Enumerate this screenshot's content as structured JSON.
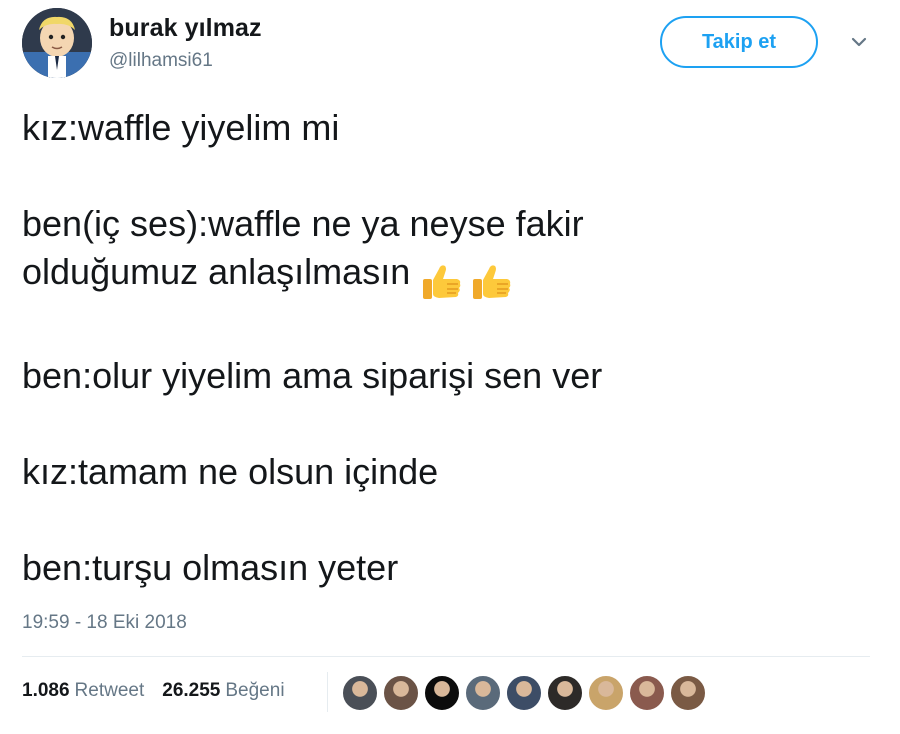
{
  "author": {
    "display_name": "burak yılmaz",
    "handle": "@lilhamsi61",
    "avatar_icon": "cartoon-character-avatar"
  },
  "follow_button": {
    "label": "Takip et",
    "color": "#1da1f2"
  },
  "menu_icon": "chevron-down-icon",
  "tweet": {
    "lines": [
      "kız:waffle yiyelim mi",
      "ben(iç ses):waffle ne ya neyse fakir",
      "olduğumuz anlaşılmasın",
      "ben:olur yiyelim ama siparişi sen ver",
      "kız:tamam ne olsun içinde",
      "ben:turşu olmasın yeter"
    ],
    "emoji": [
      "thumbs-up-emoji",
      "thumbs-up-emoji"
    ]
  },
  "timestamp": "19:59 - 18 Eki 2018",
  "stats": {
    "retweets": {
      "count": "1.086",
      "label": "Retweet"
    },
    "likes": {
      "count": "26.255",
      "label": "Beğeni"
    }
  },
  "likers": [
    {
      "name": "liker-avatar-1",
      "color": "#4a4f57"
    },
    {
      "name": "liker-avatar-2",
      "color": "#6b5346"
    },
    {
      "name": "liker-avatar-3",
      "color": "#0c0c0c"
    },
    {
      "name": "liker-avatar-4",
      "color": "#5a6a7a"
    },
    {
      "name": "liker-avatar-5",
      "color": "#3d4d66"
    },
    {
      "name": "liker-avatar-6",
      "color": "#2d2a28"
    },
    {
      "name": "liker-avatar-7",
      "color": "#c9a46a"
    },
    {
      "name": "liker-avatar-8",
      "color": "#8a5a4e"
    },
    {
      "name": "liker-avatar-9",
      "color": "#7a5a44"
    }
  ]
}
